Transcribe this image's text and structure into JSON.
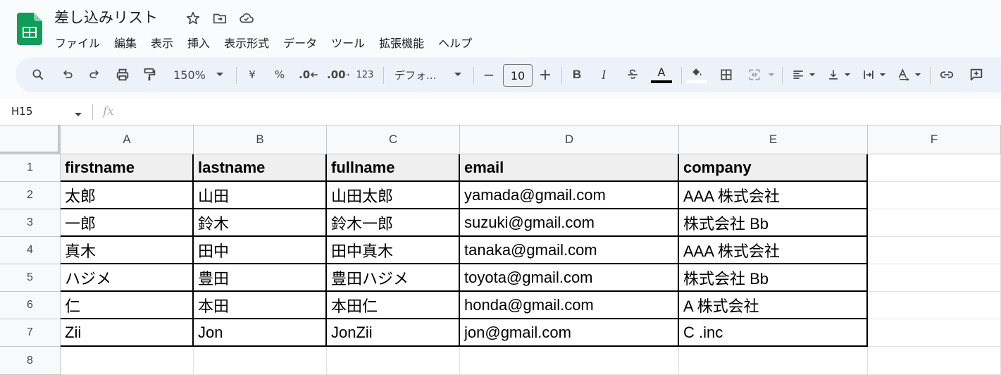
{
  "doc": {
    "title": "差し込みリスト",
    "menu": [
      "ファイル",
      "編集",
      "表示",
      "挿入",
      "表示形式",
      "データ",
      "ツール",
      "拡張機能",
      "ヘルプ"
    ]
  },
  "toolbar": {
    "zoom": "150%",
    "currency": "¥",
    "percent": "%",
    "decimal_decrease": ".0",
    "decimal_increase": ".00",
    "number_format": "123",
    "font": "デフォ...",
    "font_size": "10",
    "minus": "−",
    "plus": "+",
    "bold": "B",
    "italic": "I",
    "text_color": "A"
  },
  "formula_bar": {
    "cell_ref": "H15",
    "fx": "fx"
  },
  "colors": {
    "accent_green": "#0f9d58",
    "header_fill": "#efefef",
    "toolbar_bg": "#edf2fa"
  },
  "sheet": {
    "columns": [
      "A",
      "B",
      "C",
      "D",
      "E",
      "F"
    ],
    "rows": [
      "1",
      "2",
      "3",
      "4",
      "5",
      "6",
      "7",
      "8"
    ],
    "header": [
      "firstname",
      "lastname",
      "fullname",
      "email",
      "company"
    ],
    "data": [
      [
        "太郎",
        "山田",
        "山田太郎",
        "yamada@gmail.com",
        "AAA 株式会社"
      ],
      [
        "一郎",
        "鈴木",
        "鈴木一郎",
        "suzuki@gmail.com",
        "株式会社 Bb"
      ],
      [
        "真木",
        "田中",
        "田中真木",
        "tanaka@gmail.com",
        "AAA 株式会社"
      ],
      [
        "ハジメ",
        "豊田",
        "豊田ハジメ",
        "toyota@gmail.com",
        "株式会社 Bb"
      ],
      [
        "仁",
        "本田",
        "本田仁",
        "honda@gmail.com",
        "A 株式会社"
      ],
      [
        "Zii",
        "Jon",
        "JonZii",
        "jon@gmail.com",
        "C .inc"
      ]
    ]
  }
}
